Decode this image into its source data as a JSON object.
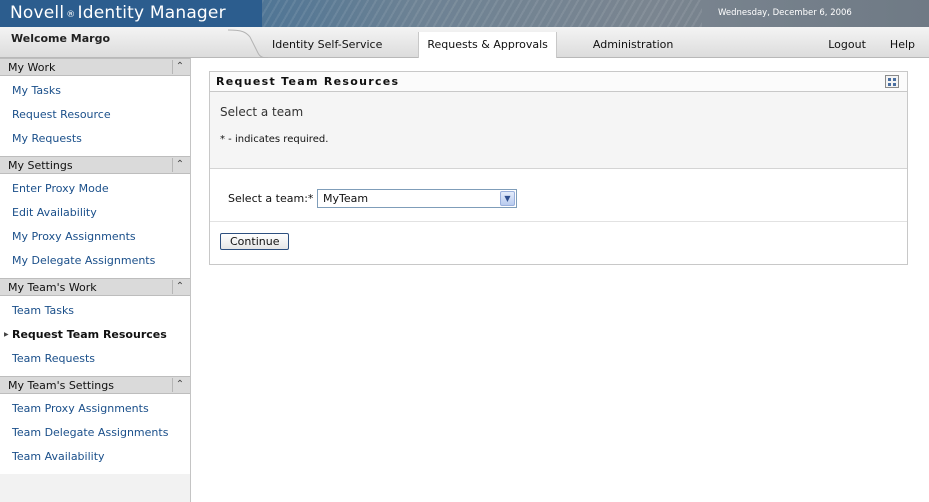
{
  "header": {
    "brand_part1": "Novell",
    "brand_reg": "®",
    "brand_part2": "Identity Manager",
    "date": "Wednesday, December 6, 2006",
    "welcome": "Welcome Margo"
  },
  "nav": {
    "tabs": [
      {
        "label": "Identity Self-Service",
        "active": false
      },
      {
        "label": "Requests & Approvals",
        "active": true
      },
      {
        "label": "Administration",
        "active": false
      }
    ],
    "links": [
      {
        "label": "Logout"
      },
      {
        "label": "Help"
      }
    ]
  },
  "sidebar": {
    "sections": [
      {
        "title": "My Work",
        "items": [
          "My Tasks",
          "Request Resource",
          "My Requests"
        ]
      },
      {
        "title": "My Settings",
        "items": [
          "Enter Proxy Mode",
          "Edit Availability",
          "My Proxy Assignments",
          "My Delegate Assignments"
        ]
      },
      {
        "title": "My Team's Work",
        "items": [
          "Team Tasks",
          "Request Team Resources",
          "Team Requests"
        ],
        "active_item": "Request Team Resources"
      },
      {
        "title": "My Team's Settings",
        "items": [
          "Team Proxy Assignments",
          "Team Delegate Assignments",
          "Team Availability"
        ]
      }
    ]
  },
  "main": {
    "panel_title": "Request Team Resources",
    "subtitle": "Select a team",
    "required_note": "* - indicates required.",
    "team_label": "Select a team:*",
    "team_value": "MyTeam",
    "continue_label": "Continue"
  },
  "icons": {
    "collapse": "collapse-up-icon",
    "panel_menu": "panel-menu-icon",
    "dropdown": "chevron-down-icon",
    "active_arrow": "active-arrow-icon"
  }
}
